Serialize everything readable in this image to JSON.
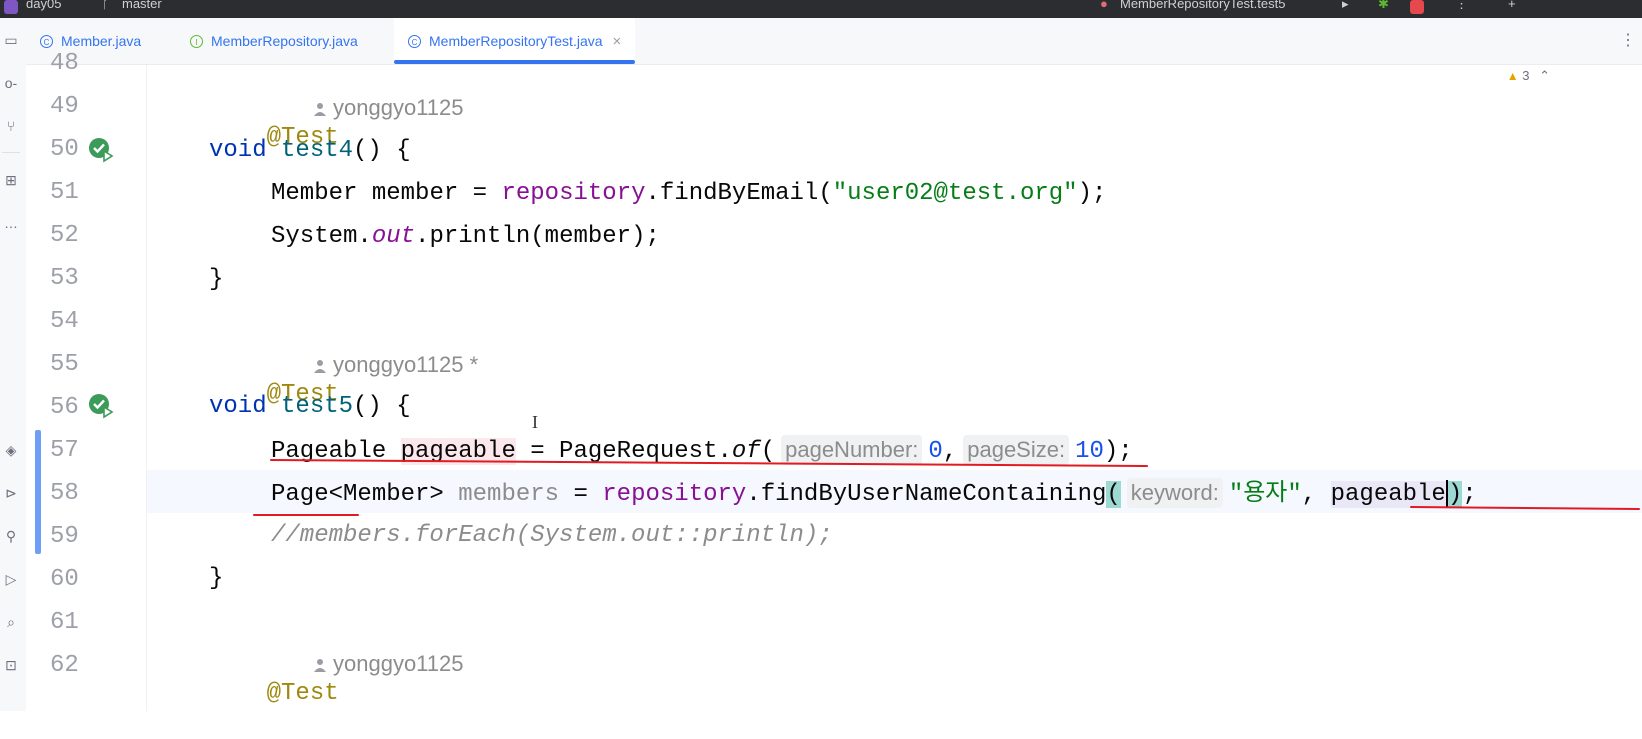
{
  "titlebar": {
    "project": "day05",
    "branch": "master",
    "run_config": "MemberRepositoryTest.test5"
  },
  "sidebar": {
    "icons": [
      "project-icon",
      "commit-icon",
      "pull-requests-icon",
      "structure-icon",
      "more-icon",
      "layers-icon",
      "services-icon",
      "problems-icon",
      "run-icon",
      "find-icon",
      "terminal-icon"
    ]
  },
  "tabs": [
    {
      "label": "Member.java",
      "icon": "class-icon",
      "active": false
    },
    {
      "label": "MemberRepository.java",
      "icon": "interface-icon",
      "active": false
    },
    {
      "label": "MemberRepositoryTest.java",
      "icon": "test-class-icon",
      "active": true,
      "close": "×"
    }
  ],
  "tabs_menu": "⋮",
  "inspections": {
    "count": "3"
  },
  "code": {
    "lines": [
      {
        "num": "48"
      },
      {
        "num": "49",
        "annotation": "@Test",
        "author": "yonggyo1125"
      },
      {
        "num": "50",
        "kw": "void",
        "method": "test4",
        "rest": "() {"
      },
      {
        "num": "51",
        "type": "Member",
        "var": "member",
        "eq": " = ",
        "field": "repository",
        "call": ".findByEmail(",
        "str": "\"user02@test.org\"",
        "end": ");"
      },
      {
        "num": "52",
        "cls": "System.",
        "field": "out",
        "call": ".println(member);"
      },
      {
        "num": "53",
        "brace": "}"
      },
      {
        "num": "54"
      },
      {
        "num": "55",
        "annotation": "@Test",
        "author": "yonggyo1125 *"
      },
      {
        "num": "56",
        "kw": "void",
        "method": "test5",
        "rest": "() {"
      },
      {
        "num": "57",
        "type": "Pageable",
        "var": "pageable",
        "eq": " = PageRequest.",
        "italic": "of",
        "open": "(",
        "hint1": "pageNumber:",
        "num1": "0",
        "comma": ",",
        "hint2": "pageSize:",
        "num2": "10",
        "end": ");"
      },
      {
        "num": "58",
        "type": "Page<Member>",
        "var": "members",
        "eq": " = ",
        "field": "repository",
        "call": ".findByUserNameContaining",
        "open": "(",
        "hint": "keyword:",
        "str": "\"용자\"",
        "comma": ", ",
        "arg": "pageable",
        "close": ")",
        "end": ";"
      },
      {
        "num": "59",
        "comment": "//members.forEach(System.out::println);"
      },
      {
        "num": "60",
        "brace": "}"
      },
      {
        "num": "61"
      },
      {
        "num": "62",
        "annotation": "@Test",
        "author": "yonggyo1125"
      }
    ]
  },
  "colors": {
    "keyword": "#0033b3",
    "annotation": "#9e880d",
    "string": "#067d17",
    "field": "#871094",
    "accent": "#3574f0",
    "error_underline": "#e01b24"
  }
}
